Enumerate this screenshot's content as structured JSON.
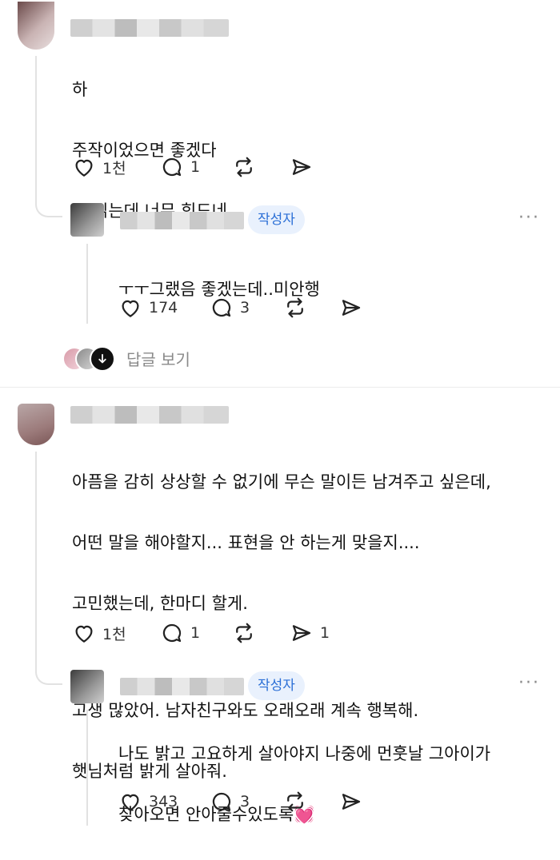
{
  "comments": [
    {
      "lines": [
        "하",
        "주작이었으면 좋겠다",
        "글 읽는데 너무 힘드네"
      ],
      "likes": "1천",
      "replies": "1",
      "shares": ""
    },
    {
      "lines": [
        "아픔을 감히 상상할 수 없기에 무슨 말이든 남겨주고 싶은데,",
        "어떤 말을 해야할지... 표현을 안 하는게 맞을지....",
        "고민했는데, 한마디 할게.",
        "",
        "고생 많았어. 남자친구와도 오래오래 계속 행복해.",
        "햇님처럼 밝게 살아줘."
      ],
      "likes": "1천",
      "replies": "1",
      "shares": "1"
    }
  ],
  "author_replies": [
    {
      "badge": "작성자",
      "lines": [
        "ㅜㅜ그랬음 좋겠는데..미안행"
      ],
      "likes": "174",
      "replies": "3"
    },
    {
      "badge": "작성자",
      "lines": [
        "나도 밝고 고요하게 살아야지 나중에 먼훗날 그아이가",
        "찾아오면 안아줄수있도록💓"
      ],
      "likes": "343",
      "replies": "3"
    }
  ],
  "view_replies_label": "답글 보기",
  "more_label": "···",
  "icons": [
    "heart-icon",
    "comment-icon",
    "repost-icon",
    "share-icon",
    "arrow-down-icon"
  ]
}
